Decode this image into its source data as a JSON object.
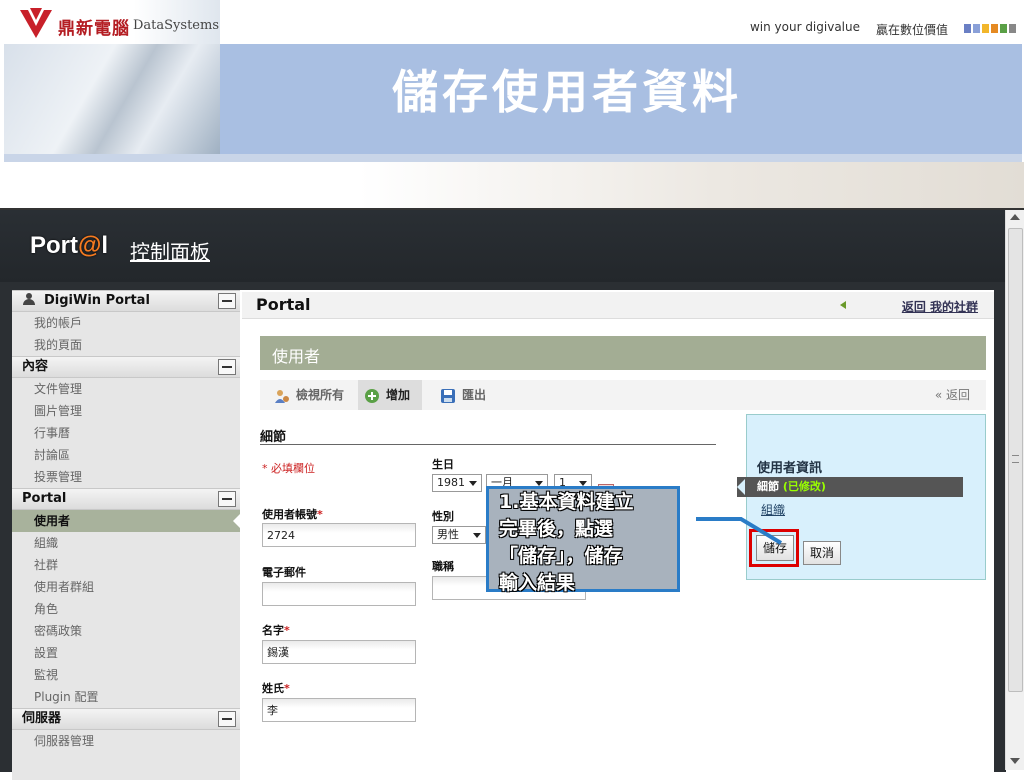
{
  "slide": {
    "logo_cn": "鼎新電腦",
    "logo_en": "DataSystems",
    "slogan": "win your digivalue",
    "slogan_cn": "贏在數位價值",
    "title": "儲存使用者資料",
    "squares": [
      "#6a7fc4",
      "#8aa0d8",
      "#f2b62b",
      "#e58a22",
      "#5aa046",
      "#888888"
    ]
  },
  "dock": {
    "logo_prefix": "Port",
    "logo_at": "@",
    "logo_suffix": "l",
    "control_panel": "控制面板"
  },
  "sidebar": {
    "sections": [
      {
        "title": "DigiWin Portal",
        "items": [
          "我的帳戶",
          "我的頁面"
        ]
      },
      {
        "title": "內容",
        "items": [
          "文件管理",
          "圖片管理",
          "行事曆",
          "討論區",
          "投票管理"
        ]
      },
      {
        "title": "Portal",
        "items": [
          "使用者",
          "組織",
          "社群",
          "使用者群組",
          "角色",
          "密碼政策",
          "設置",
          "監視",
          "Plugin 配置"
        ]
      },
      {
        "title": "伺服器",
        "items": [
          "伺服器管理"
        ]
      }
    ],
    "active_item": "使用者"
  },
  "main": {
    "portlet_title": "Portal",
    "back_link": "返回 我的社群",
    "section_title": "使用者",
    "toolbar": {
      "view_all": "檢視所有",
      "add": "增加",
      "export": "匯出",
      "back": "« 返回"
    },
    "details_label": "細節",
    "required_note": "* 必填欄位"
  },
  "form": {
    "screen_name_label": "使用者帳號",
    "screen_name_value": "2724",
    "email_label": "電子郵件",
    "email_value": "",
    "first_name_label": "名字",
    "first_name_value": "錫漢",
    "last_name_label": "姓氏",
    "last_name_value": "李",
    "birthday_label": "生日",
    "birthday_year": "1981",
    "birthday_month": "一月",
    "birthday_day": "1",
    "gender_label": "性別",
    "gender_value": "男性",
    "job_title_label": "職稱",
    "job_title_value": ""
  },
  "info_box": {
    "title": "使用者資訊",
    "current": "細節",
    "current_flag": "(已修改)",
    "org_link": "組織",
    "save_label": "儲存",
    "cancel_label": "取消"
  },
  "annotation": {
    "text": "1.基本資料建立\n完畢後，點選\n「儲存」，儲存\n輸入結果"
  }
}
